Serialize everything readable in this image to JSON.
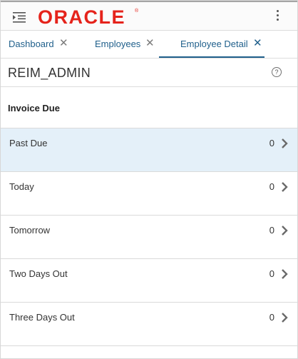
{
  "header": {
    "logo_text": "ORACLE",
    "logo_mark": "®",
    "menu_icon": "hamburger-indent-icon",
    "more_icon": "vertical-dots-icon",
    "brand_color": "#e5231b"
  },
  "tabs": [
    {
      "label": "Dashboard",
      "close": "✕",
      "active": false
    },
    {
      "label": "Employees",
      "close": "✕",
      "active": false
    },
    {
      "label": "Employee Detail",
      "close": "✕",
      "active": true
    }
  ],
  "page": {
    "title": "REIM_ADMIN",
    "help_glyph": "?"
  },
  "section": {
    "title": "Invoice Due"
  },
  "rows": [
    {
      "label": "Past Due",
      "count": "0",
      "selected": true
    },
    {
      "label": "Today",
      "count": "0",
      "selected": false
    },
    {
      "label": "Tomorrow",
      "count": "0",
      "selected": false
    },
    {
      "label": "Two Days Out",
      "count": "0",
      "selected": false
    },
    {
      "label": "Three Days Out",
      "count": "0",
      "selected": false
    }
  ],
  "colors": {
    "accent": "#1f5f8b",
    "selected_row": "#e4f0f9"
  }
}
